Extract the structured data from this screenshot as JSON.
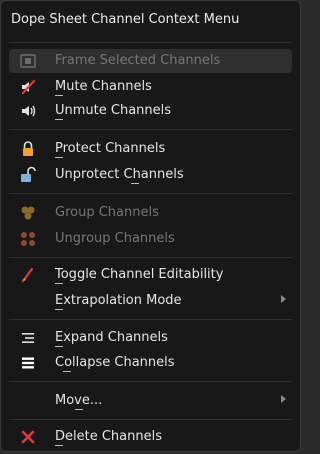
{
  "menu": {
    "title": "Dope Sheet Channel Context Menu",
    "items": [
      {
        "label": "Frame Selected Channels",
        "icon": "frame-selected-icon",
        "enabled": false
      },
      {
        "label": "Mute Channels",
        "icon": "mute-icon",
        "enabled": true
      },
      {
        "label": "Unmute Channels",
        "icon": "unmute-icon",
        "enabled": true
      },
      {
        "label": "Protect Channels",
        "icon": "lock-closed-icon",
        "enabled": true
      },
      {
        "label": "Unprotect Channels",
        "icon": "lock-open-icon",
        "enabled": true
      },
      {
        "label": "Group Channels",
        "icon": "group-icon",
        "enabled": false
      },
      {
        "label": "Ungroup Channels",
        "icon": "ungroup-icon",
        "enabled": false
      },
      {
        "label": "Toggle Channel Editability",
        "icon": "edit-toggle-icon",
        "enabled": true
      },
      {
        "label": "Extrapolation Mode",
        "icon": "",
        "enabled": true,
        "submenu": true
      },
      {
        "label": "Expand Channels",
        "icon": "expand-icon",
        "enabled": true
      },
      {
        "label": "Collapse Channels",
        "icon": "collapse-icon",
        "enabled": true
      },
      {
        "label": "Move...",
        "icon": "",
        "enabled": true,
        "submenu": true
      },
      {
        "label": "Delete Channels",
        "icon": "delete-x-icon",
        "enabled": true
      }
    ]
  },
  "colors": {
    "background": "#181818",
    "text": "#e6e6e6",
    "disabled_text": "#767676",
    "accent_orange": "#f0a030",
    "delete_red": "#e03a3a",
    "icon_blue": "#7fb0e0"
  }
}
